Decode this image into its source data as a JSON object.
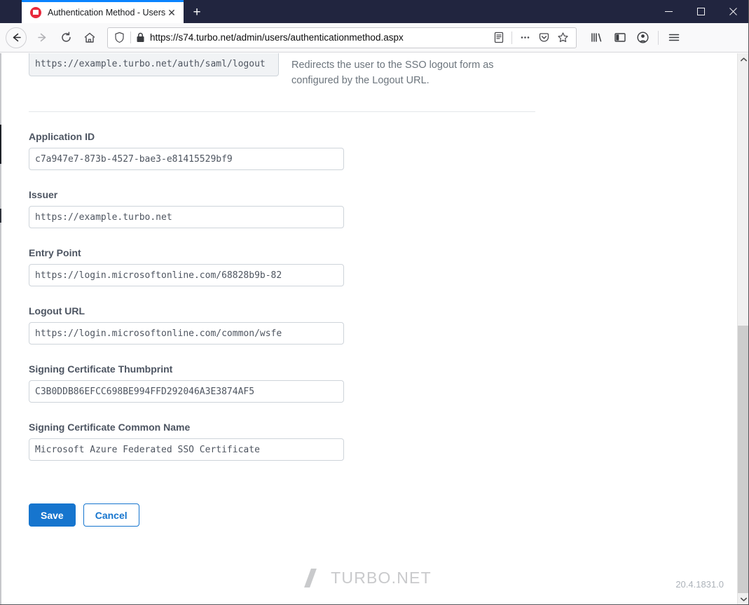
{
  "window": {
    "controls": {
      "minimize": "─",
      "maximize": "□",
      "close": "✕"
    }
  },
  "browser": {
    "tab": {
      "title": "Authentication Method - Users",
      "close_label": "✕",
      "favicon": "turbo-favicon"
    },
    "new_tab_label": "+",
    "nav": {
      "back": "back-arrow",
      "forward": "forward-arrow",
      "reload": "reload-arrow",
      "home": "home-house"
    },
    "url": "https://s74.turbo.net/admin/users/authenticationmethod.aspx",
    "url_icons": {
      "tracking_shield": "shield-icon",
      "site_security": "lock-icon",
      "reader_view": "reader-view-icon",
      "page_actions": "ellipsis-icon",
      "pocket": "pocket-icon",
      "bookmark": "star-icon"
    },
    "toolbar_icons": {
      "library": "library-icon",
      "sidebar": "sidebar-icon",
      "account": "account-icon",
      "menu": "hamburger-menu-icon"
    }
  },
  "page": {
    "logout_row": {
      "value": "https://example.turbo.net/auth/saml/logout",
      "help_line1": "Redirects the user to the SSO logout form as",
      "help_line2": "configured by the Logout URL."
    },
    "fields": [
      {
        "id": "application-id",
        "label": "Application ID",
        "value": "c7a947e7-873b-4527-bae3-e81415529bf9"
      },
      {
        "id": "issuer",
        "label": "Issuer",
        "value": "https://example.turbo.net"
      },
      {
        "id": "entry-point",
        "label": "Entry Point",
        "value": "https://login.microsoftonline.com/68828b9b-82"
      },
      {
        "id": "logout-url",
        "label": "Logout URL",
        "value": "https://login.microsoftonline.com/common/wsfe"
      },
      {
        "id": "signing-certificate-thumbprint",
        "label": "Signing Certificate Thumbprint",
        "value": "C3B0DDB86EFCC698BE994FFD292046A3E3874AF5"
      },
      {
        "id": "signing-certificate-common-name",
        "label": "Signing Certificate Common Name",
        "value": "Microsoft Azure Federated SSO Certificate"
      }
    ],
    "buttons": {
      "save": "Save",
      "cancel": "Cancel"
    },
    "footer": {
      "brand": "TURBO.NET",
      "version": "20.4.1831.0"
    },
    "colors": {
      "primary": "#1675ce",
      "label": "#4d5562",
      "help": "#6c757d",
      "input_text": "#4e5560",
      "footer_brand": "#c9cacc"
    }
  }
}
